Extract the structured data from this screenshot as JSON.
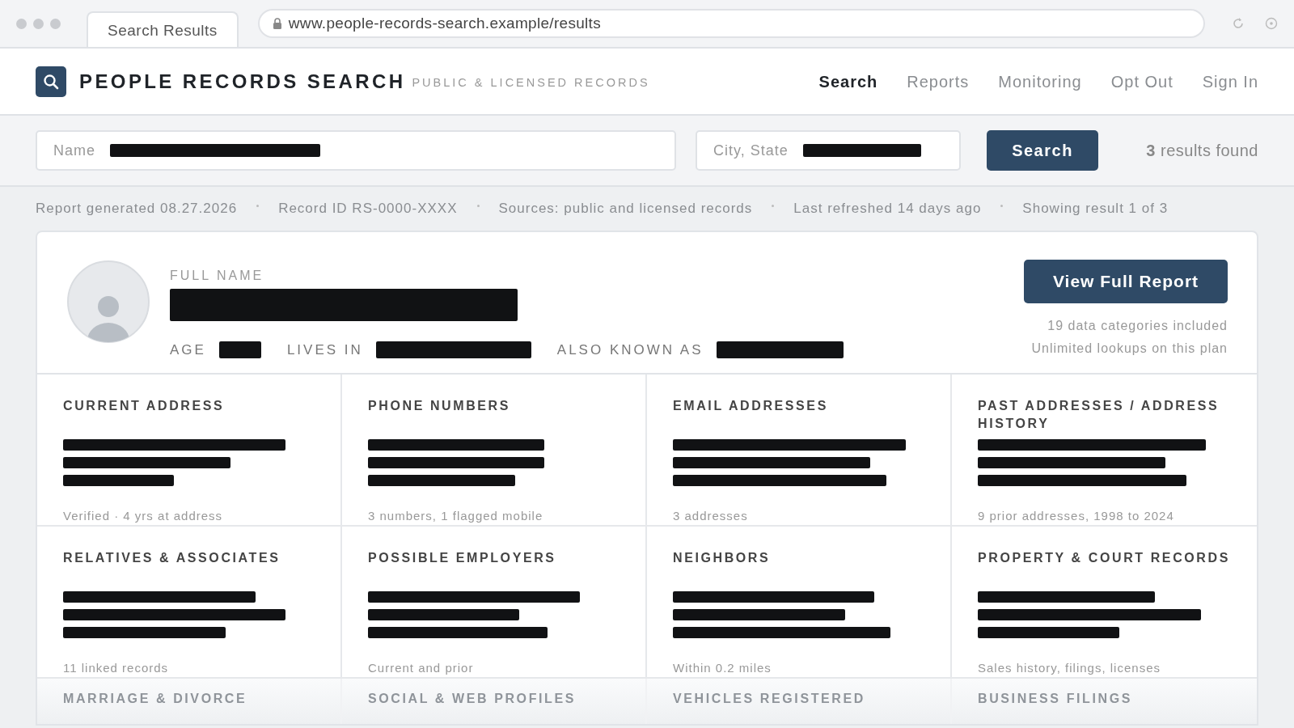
{
  "browser": {
    "tab_title": "Search Results",
    "url": "www.people-records-search.example/results"
  },
  "brand": {
    "title": "PEOPLE RECORDS SEARCH",
    "tagline": "PUBLIC & LICENSED RECORDS"
  },
  "nav": [
    {
      "label": "Search",
      "selected": true
    },
    {
      "label": "Reports",
      "selected": false
    },
    {
      "label": "Monitoring",
      "selected": false
    },
    {
      "label": "Opt Out",
      "selected": false
    },
    {
      "label": "Sign In",
      "selected": false
    }
  ],
  "search": {
    "fields": [
      {
        "label": "Name",
        "kind": "wide"
      },
      {
        "label": "City, State",
        "kind": "narrow"
      }
    ],
    "button": "Search",
    "results": "**3** results found"
  },
  "meta": [
    "Report generated 08.27.2026",
    "Record ID RS-0000-XXXX",
    "Sources: public and licensed records",
    "Last refreshed 14 days ago",
    "Showing result 1 of 3"
  ],
  "profile": {
    "name_label": "FULL NAME",
    "facts": [
      {
        "label": "AGE",
        "kind": "short"
      },
      {
        "label": "LIVES IN",
        "kind": "long"
      },
      {
        "label": "ALSO KNOWN AS",
        "kind": "medium"
      }
    ],
    "button": "View Full Report",
    "notes": [
      "19 data categories included",
      "Unlimited lookups on this plan"
    ]
  },
  "categories": [
    {
      "title": "CURRENT ADDRESS",
      "note": "Verified · 4 yrs at address",
      "faded": false
    },
    {
      "title": "PHONE NUMBERS",
      "note": "3 numbers, 1 flagged mobile",
      "faded": false
    },
    {
      "title": "EMAIL ADDRESSES",
      "note": "3 addresses",
      "faded": false
    },
    {
      "title": "PAST ADDRESSES / ADDRESS HISTORY",
      "note": "9 prior addresses, 1998 to 2024",
      "faded": false
    },
    {
      "title": "RELATIVES & ASSOCIATES",
      "note": "11 linked records",
      "faded": false
    },
    {
      "title": "POSSIBLE EMPLOYERS",
      "note": "Current and prior",
      "faded": false
    },
    {
      "title": "NEIGHBORS",
      "note": "Within 0.2 miles",
      "faded": false
    },
    {
      "title": "PROPERTY & COURT RECORDS",
      "note": "Sales history, filings, licenses",
      "faded": false
    },
    {
      "title": "MARRIAGE & DIVORCE",
      "faded": true
    },
    {
      "title": "SOCIAL & WEB PROFILES",
      "faded": true
    },
    {
      "title": "VEHICLES REGISTERED",
      "faded": true
    },
    {
      "title": "BUSINESS FILINGS",
      "faded": true
    }
  ]
}
